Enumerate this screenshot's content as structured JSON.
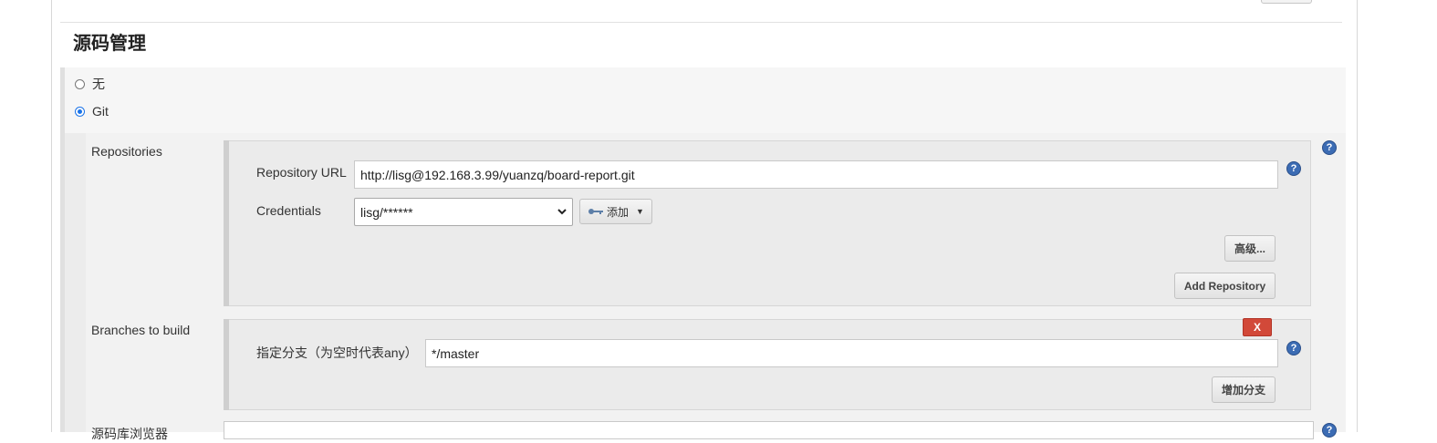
{
  "section": {
    "title": "源码管理"
  },
  "scm_options": [
    {
      "label": "无",
      "selected": false
    },
    {
      "label": "Git",
      "selected": true
    }
  ],
  "repositories": {
    "label": "Repositories",
    "url_label": "Repository URL",
    "url_value": "http://lisg@192.168.3.99/yuanzq/board-report.git",
    "credentials_label": "Credentials",
    "credentials_value": "lisg/******",
    "add_button": "添加",
    "advanced_button": "高级...",
    "add_repository_button": "Add Repository"
  },
  "branches": {
    "label": "Branches to build",
    "branch_label": "指定分支（为空时代表any）",
    "branch_value": "*/master",
    "delete_button": "X",
    "add_branch_button": "增加分支"
  },
  "next_section": {
    "label": "源码库浏览器"
  },
  "help_icon_text": "?",
  "colors": {
    "help": "#3c6cb4",
    "delete": "#d24939",
    "radio_checked": "#1a73e8"
  }
}
